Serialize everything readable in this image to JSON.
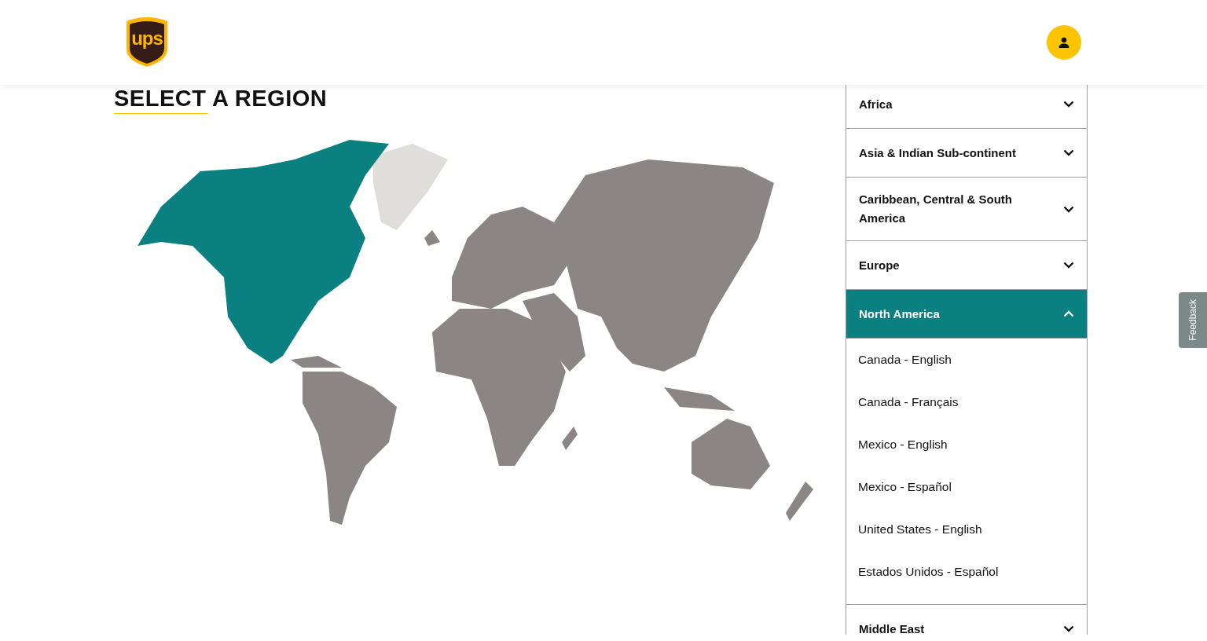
{
  "header": {
    "logo_text": "ups"
  },
  "title": "SELECT A REGION",
  "regions": [
    {
      "label": "Africa",
      "expanded": false
    },
    {
      "label": "Asia & Indian Sub-continent",
      "expanded": false
    },
    {
      "label": "Caribbean, Central & South America",
      "expanded": false
    },
    {
      "label": "Europe",
      "expanded": false
    },
    {
      "label": "North America",
      "expanded": true,
      "countries": [
        "Canada - English",
        "Canada - Français",
        "Mexico - English",
        "Mexico - Español",
        "United States - English",
        "Estados Unidos - Español"
      ]
    },
    {
      "label": "Middle East",
      "expanded": false
    }
  ],
  "feedback_tab": "Feedback"
}
